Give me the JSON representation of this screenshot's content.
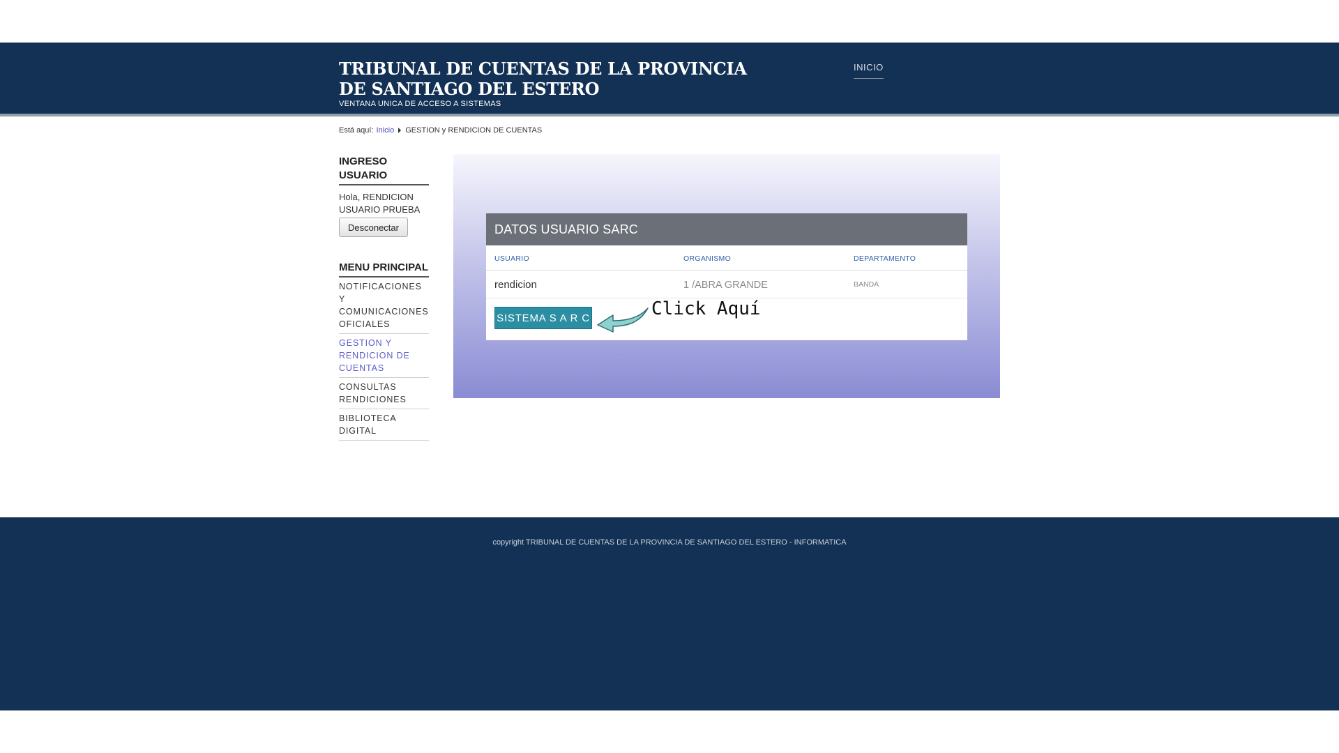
{
  "header": {
    "title": "TRIBUNAL DE CUENTAS DE LA PROVINCIA DE SANTIAGO DEL ESTERO",
    "subtitle": "VENTANA UNICA DE ACCESO A SISTEMAS",
    "nav_inicio": "INICIO"
  },
  "breadcrumb": {
    "prefix": "Está aquí:",
    "home": "Inicio",
    "current": "GESTION y RENDICION DE CUENTAS"
  },
  "sidebar": {
    "login_heading": "INGRESO USUARIO",
    "greeting": "Hola, RENDICION USUARIO PRUEBA",
    "logout_label": "Desconectar",
    "menu_heading": "MENU PRINCIPAL",
    "menu": [
      {
        "label": "NOTIFICACIONES Y COMUNICACIONES OFICIALES"
      },
      {
        "label": "GESTION Y RENDICION DE CUENTAS",
        "active": true
      },
      {
        "label": "CONSULTAS RENDICIONES"
      },
      {
        "label": "BIBLIOTECA DIGITAL"
      }
    ]
  },
  "card": {
    "title": "DATOS USUARIO SARC",
    "columns": [
      "USUARIO",
      "ORGANISMO",
      "DEPARTAMENTO"
    ],
    "row": {
      "usuario": "rendicion",
      "organismo": "1 /ABRA GRANDE",
      "departamento": "BANDA"
    },
    "sarc_button": "SISTEMA S A R C",
    "click_hint": "Click Aquí"
  },
  "footer": {
    "copyright": "copyright TRIBUNAL DE CUENTAS DE LA PROVINCIA DE SANTIAGO DEL ESTERO - INFORMATICA"
  },
  "colors": {
    "header_bg": "#133154",
    "card_header": "#6b6f77",
    "sarc_button": "#2b8ea3",
    "active_link": "#5b5bc9"
  }
}
